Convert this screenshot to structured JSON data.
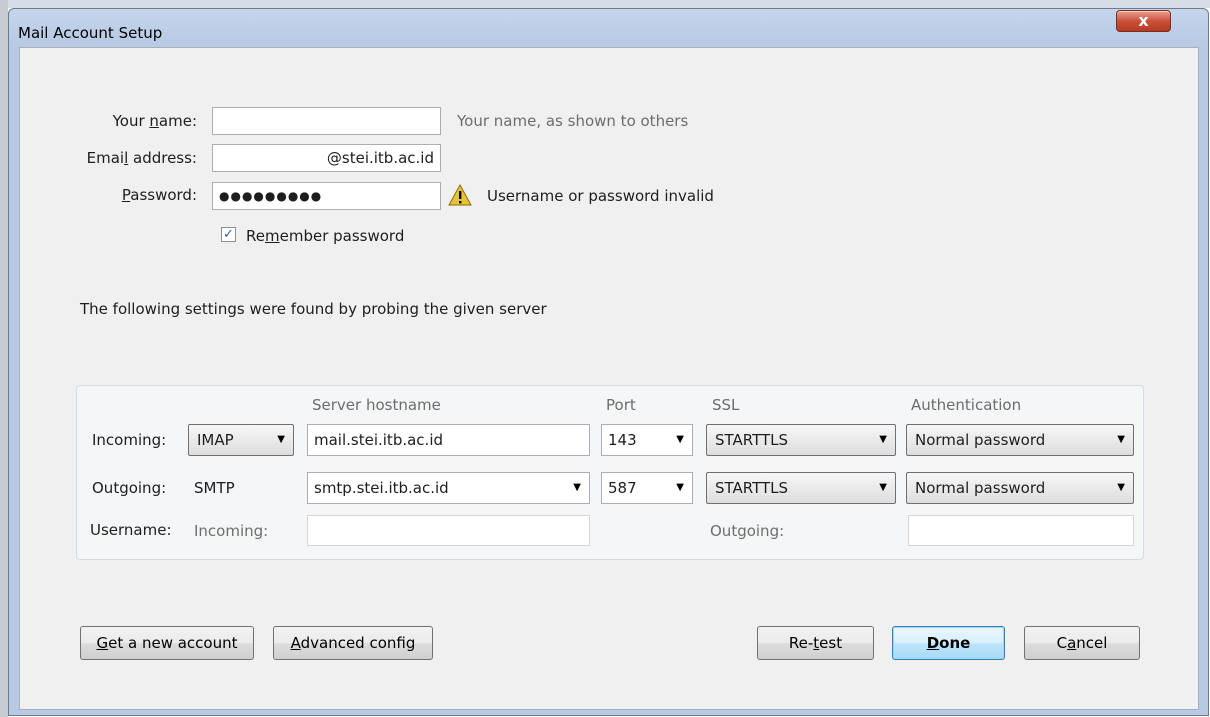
{
  "window": {
    "title": "Mail Account Setup",
    "close_glyph": "x"
  },
  "identity": {
    "name_label_pre": "Your ",
    "name_label_key": "n",
    "name_label_post": "ame:",
    "name_value": "",
    "name_hint": "Your name, as shown to others",
    "email_label_pre": "Emai",
    "email_label_key": "l",
    "email_label_post": " address:",
    "email_value": "@stei.itb.ac.id",
    "password_label_key": "P",
    "password_label_post": "assword:",
    "password_value": "●●●●●●●●●",
    "password_warning": "Username or password invalid",
    "remember_label_pre": "Re",
    "remember_label_key": "m",
    "remember_label_post": "ember password",
    "remember_checked": true
  },
  "probe_message": "The following settings were found by probing the given server",
  "server_settings": {
    "headers": {
      "hostname": "Server hostname",
      "port": "Port",
      "ssl": "SSL",
      "auth": "Authentication"
    },
    "incoming": {
      "label": "Incoming:",
      "protocol": "IMAP",
      "hostname": "mail.stei.itb.ac.id",
      "port": "143",
      "ssl": "STARTTLS",
      "auth": "Normal password"
    },
    "outgoing": {
      "label": "Outgoing:",
      "protocol": "SMTP",
      "hostname": "smtp.stei.itb.ac.id",
      "port": "587",
      "ssl": "STARTTLS",
      "auth": "Normal password"
    },
    "username": {
      "label": "Username:",
      "incoming_label": "Incoming:",
      "incoming_value": "",
      "outgoing_label": "Outgoing:",
      "outgoing_value": ""
    }
  },
  "buttons": {
    "get_account_key": "G",
    "get_account_post": "et a new account",
    "advanced_key": "A",
    "advanced_post": "dvanced config",
    "retest_pre": "Re-",
    "retest_key": "t",
    "retest_post": "est",
    "done_key": "D",
    "done_post": "one",
    "cancel_pre": "C",
    "cancel_key": "a",
    "cancel_post": "ncel"
  },
  "colors": {
    "warning_icon": "#e8c23a",
    "default_button_border": "#3c7fb1",
    "close_button": "#c9503a"
  },
  "icons": {
    "warning": "warning-icon",
    "check": "check-icon",
    "dropdown": "chevron-down-icon"
  }
}
